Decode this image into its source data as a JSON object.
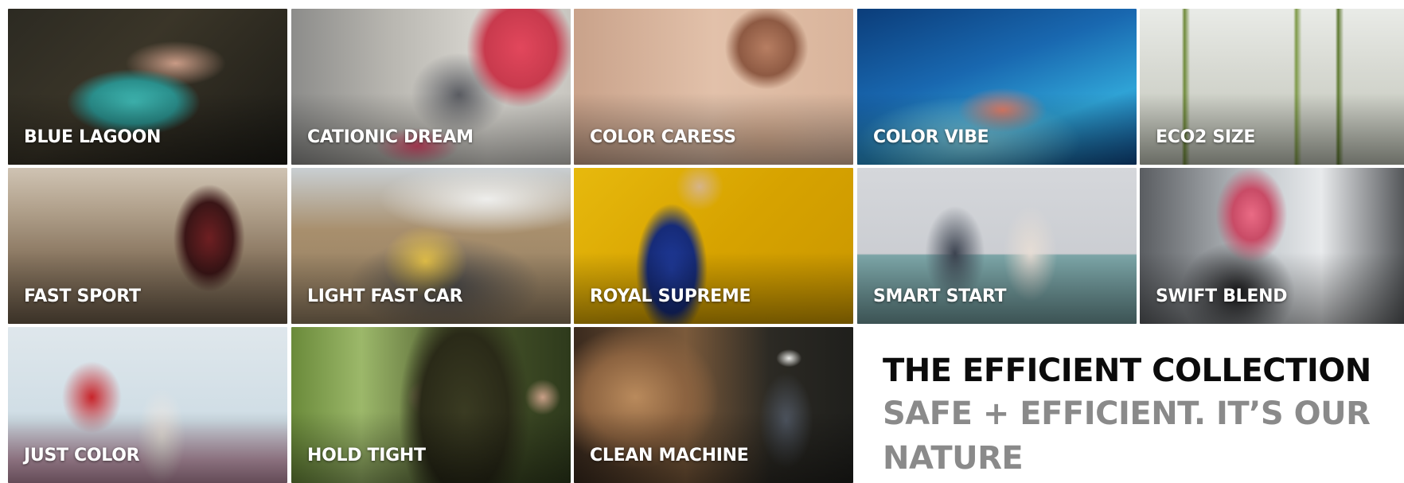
{
  "tiles": [
    {
      "label": "BLUE LAGOON"
    },
    {
      "label": "CATIONIC DREAM"
    },
    {
      "label": "COLOR CARESS"
    },
    {
      "label": "COLOR VIBE"
    },
    {
      "label": "ECO2 SIZE"
    },
    {
      "label": "FAST SPORT"
    },
    {
      "label": "LIGHT FAST CAR"
    },
    {
      "label": "ROYAL SUPREME"
    },
    {
      "label": "SMART START"
    },
    {
      "label": "SWIFT BLEND"
    },
    {
      "label": "JUST COLOR"
    },
    {
      "label": "HOLD TIGHT"
    },
    {
      "label": "CLEAN MACHINE"
    }
  ],
  "collection": {
    "title": "THE EFFICIENT COLLECTION",
    "subtitle": "SAFE + EFFICIENT. IT’S OUR NATURE"
  },
  "colors": {
    "title": "#0b0b0b",
    "subtitle": "#8a8a8a",
    "label": "#ffffff"
  }
}
